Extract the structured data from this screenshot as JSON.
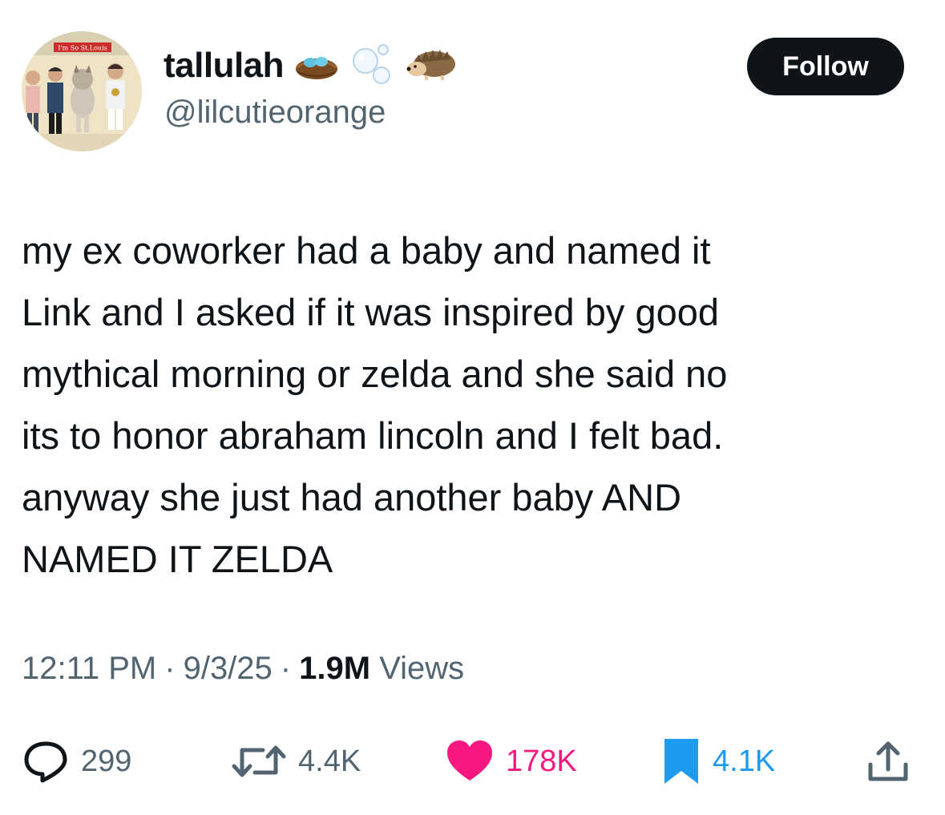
{
  "author": {
    "display_name": "tallulah",
    "handle": "@lilcutieorange",
    "name_emojis": [
      "nest-with-eggs",
      "bubbles",
      "hedgehog"
    ],
    "avatar_caption": "I'm So St.Louis"
  },
  "follow_label": "Follow",
  "tweet_text": "my ex coworker had a baby and named it\nLink and I asked if it was inspired by good\nmythical morning or zelda and she said no\nits to honor abraham lincoln and I felt bad.\nanyway she just had another baby AND\nNAMED IT ZELDA",
  "meta": {
    "time": "12:11 PM",
    "sep1": "·",
    "date": "9/3/25",
    "sep2": "·",
    "views_count": "1.9M",
    "views_label": "Views"
  },
  "actions": {
    "replies": "299",
    "reposts": "4.4K",
    "likes": "178K",
    "bookmarks": "4.1K"
  },
  "colors": {
    "text": "#0f1419",
    "secondary": "#536471",
    "like": "#f91880",
    "bookmark": "#1d9bf0"
  }
}
